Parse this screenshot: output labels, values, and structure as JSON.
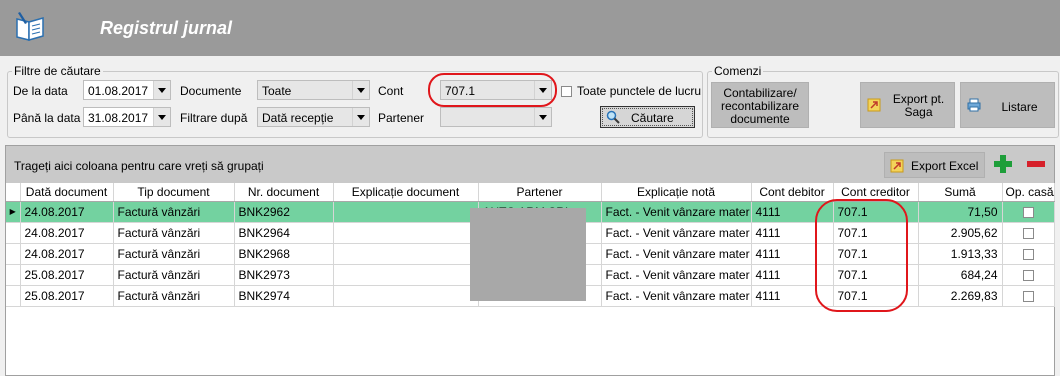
{
  "window": {
    "title": "Registrul jurnal",
    "icon": "book-pen-icon"
  },
  "filters": {
    "legend": "Filtre de căutare",
    "from_label": "De la data",
    "from_value": "01.08.2017",
    "to_label": "Până la data",
    "to_value": "31.08.2017",
    "documents_label": "Documente",
    "documents_value": "Toate",
    "filter_by_label": "Filtrare după",
    "filter_by_value": "Dată recepție",
    "account_label": "Cont",
    "account_value": "707.1",
    "partner_label": "Partener",
    "partner_value": "",
    "all_workpoints_label": "Toate punctele de lucru",
    "all_workpoints_checked": false,
    "search_label": "Căutare"
  },
  "commands": {
    "legend": "Comenzi",
    "post_label": "Contabilizare/ recontabilizare documente",
    "export_saga_label": "Export pt. Saga",
    "print_label": "Listare"
  },
  "grid": {
    "group_hint": "Trageți aici coloana pentru care vreți să grupați",
    "export_excel_label": "Export Excel",
    "add_icon": "plus-icon",
    "remove_icon": "minus-icon",
    "columns": [
      "Dată document",
      "Tip document",
      "Nr. document",
      "Explicație document",
      "Partener",
      "Explicație notă",
      "Cont debitor",
      "Cont creditor",
      "Sumă",
      "Op. casă/b"
    ],
    "rows": [
      {
        "date": "24.08.2017",
        "type": "Factură vânzări",
        "number": "BNK2962",
        "doc_expl": "",
        "partner": "AUTO ARM SRL",
        "note": "Fact. - Venit vânzare mater",
        "debit": "4111",
        "credit": "707.1",
        "amount": "71,50",
        "cash": false
      },
      {
        "date": "24.08.2017",
        "type": "Factură vânzări",
        "number": "BNK2964",
        "doc_expl": "",
        "partner": "",
        "note": "Fact. - Venit vânzare mater",
        "debit": "4111",
        "credit": "707.1",
        "amount": "2.905,62",
        "cash": false
      },
      {
        "date": "24.08.2017",
        "type": "Factură vânzări",
        "number": "BNK2968",
        "doc_expl": "",
        "partner": "",
        "note": "Fact. - Venit vânzare mater",
        "debit": "4111",
        "credit": "707.1",
        "amount": "1.913,33",
        "cash": false
      },
      {
        "date": "25.08.2017",
        "type": "Factură vânzări",
        "number": "BNK2973",
        "doc_expl": "",
        "partner": "",
        "note": "Fact. - Venit vânzare mater",
        "debit": "4111",
        "credit": "707.1",
        "amount": "684,24",
        "cash": false
      },
      {
        "date": "25.08.2017",
        "type": "Factură vânzări",
        "number": "BNK2974",
        "doc_expl": "",
        "partner": "",
        "note": "Fact. - Venit vânzare mater",
        "debit": "4111",
        "credit": "707.1",
        "amount": "2.269,83",
        "cash": false
      }
    ]
  },
  "colors": {
    "selected_row": "#73d2a0",
    "highlight_oval": "#e0161b",
    "title_bar": "#9a9a9a"
  }
}
